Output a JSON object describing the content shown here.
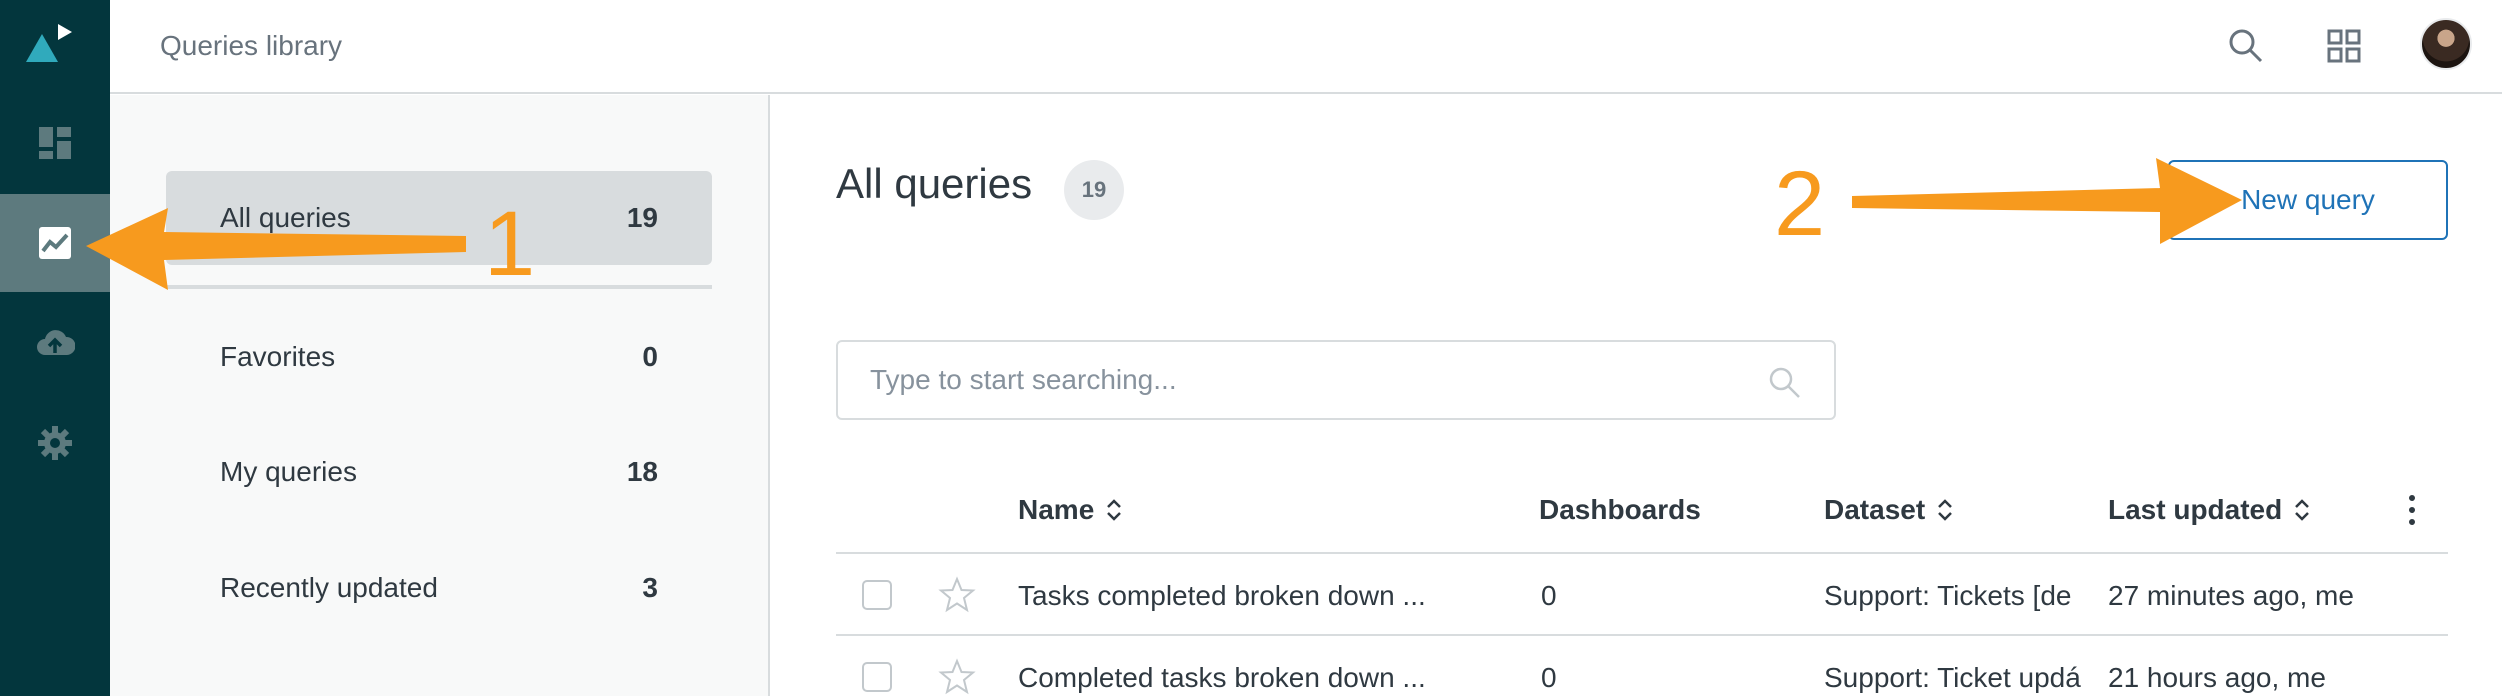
{
  "header": {
    "title": "Queries library"
  },
  "rail": {
    "items": [
      {
        "icon": "dashboard-icon",
        "active": false
      },
      {
        "icon": "chart-icon",
        "active": true
      },
      {
        "icon": "cloud-upload-icon",
        "active": false
      },
      {
        "icon": "gear-icon",
        "active": false
      }
    ]
  },
  "sidebar": {
    "filters": [
      {
        "label": "All queries",
        "count": "19"
      },
      {
        "label": "Favorites",
        "count": "0"
      },
      {
        "label": "My queries",
        "count": "18"
      },
      {
        "label": "Recently updated",
        "count": "3"
      }
    ]
  },
  "main": {
    "title": "All queries",
    "count": "19",
    "new_button": "New query",
    "search_placeholder": "Type to start searching..."
  },
  "table": {
    "columns": [
      "Name",
      "Dashboards",
      "Dataset",
      "Last updated"
    ],
    "rows": [
      {
        "name": "Tasks completed broken down ...",
        "dashboards": "0",
        "dataset": "Support: Tickets [de",
        "updated": "27 minutes ago, me"
      },
      {
        "name": "Completed tasks broken down ...",
        "dashboards": "0",
        "dataset": "Support: Ticket updá",
        "updated": "21 hours ago, me"
      }
    ]
  },
  "annotations": {
    "step1": "1",
    "step2": "2"
  },
  "colors": {
    "rail": "#03363d",
    "rail_active": "#5d7a7e",
    "accent": "#1f73b7",
    "annotation": "#f79a1e"
  }
}
